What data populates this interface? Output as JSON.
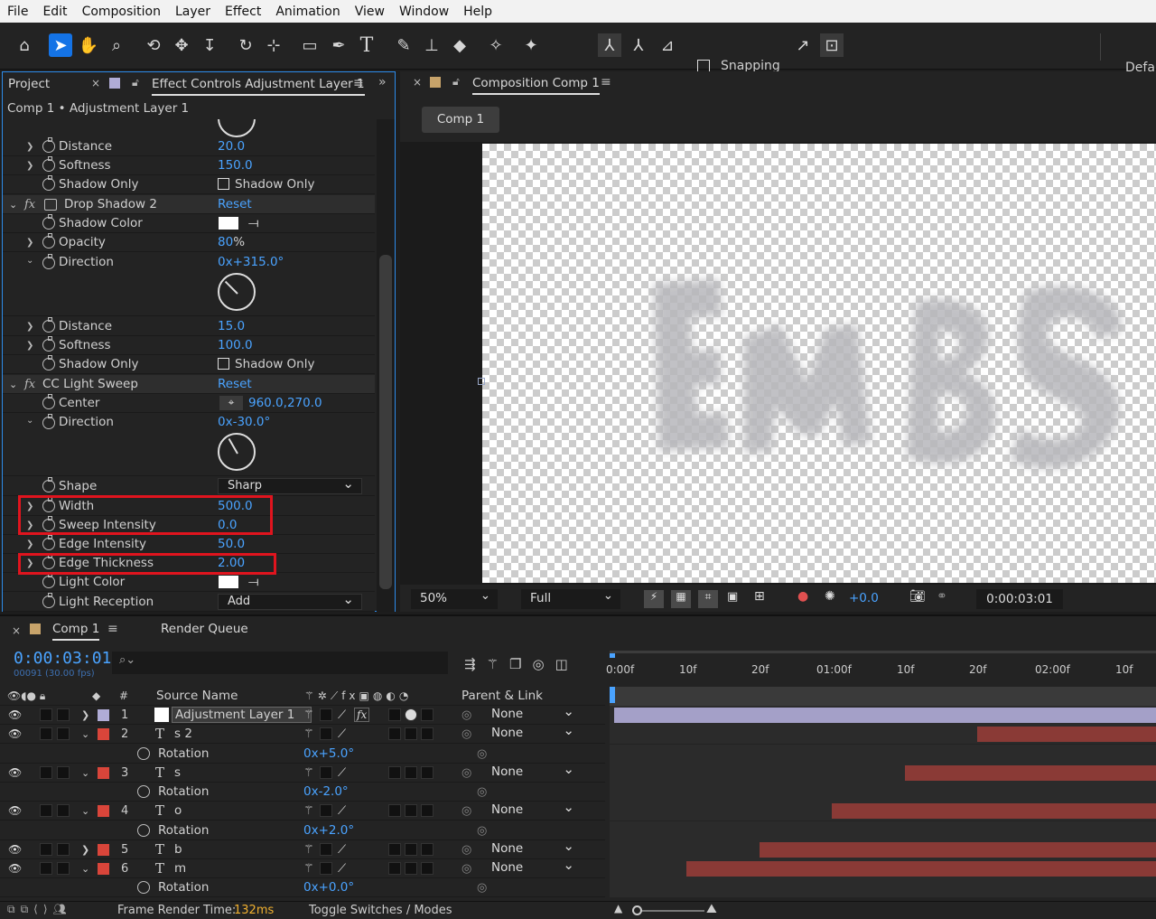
{
  "menu": [
    "File",
    "Edit",
    "Composition",
    "Layer",
    "Effect",
    "Animation",
    "View",
    "Window",
    "Help"
  ],
  "toolbar": {
    "snapping_label": "Snapping",
    "workspace": "Defau"
  },
  "effect_controls": {
    "tab_project": "Project",
    "tab_title": "Effect Controls Adjustment Layer 1",
    "breadcrumb": "Comp 1 • Adjustment Layer 1",
    "rows": {
      "distance1": {
        "label": "Distance",
        "value": "20.0"
      },
      "softness1": {
        "label": "Softness",
        "value": "150.0"
      },
      "shadow_only1": {
        "label": "Shadow Only",
        "value": "Shadow Only"
      },
      "drop_shadow2": {
        "label": "Drop Shadow 2",
        "value": "Reset"
      },
      "shadow_color": {
        "label": "Shadow Color"
      },
      "opacity": {
        "label": "Opacity",
        "value": "80",
        "unit": "%"
      },
      "direction1": {
        "label": "Direction",
        "value": "0x+315.0°"
      },
      "distance2": {
        "label": "Distance",
        "value": "15.0"
      },
      "softness2": {
        "label": "Softness",
        "value": "100.0"
      },
      "shadow_only2": {
        "label": "Shadow Only",
        "value": "Shadow Only"
      },
      "light_sweep": {
        "label": "CC Light Sweep",
        "value": "Reset"
      },
      "center": {
        "label": "Center",
        "value": "960.0,270.0"
      },
      "direction2": {
        "label": "Direction",
        "value": "0x-30.0°"
      },
      "shape": {
        "label": "Shape",
        "value": "Sharp"
      },
      "width": {
        "label": "Width",
        "value": "500.0"
      },
      "sweep_intensity": {
        "label": "Sweep Intensity",
        "value": "0.0"
      },
      "edge_intensity": {
        "label": "Edge Intensity",
        "value": "50.0"
      },
      "edge_thickness": {
        "label": "Edge Thickness",
        "value": "2.00"
      },
      "light_color": {
        "label": "Light Color"
      },
      "light_reception": {
        "label": "Light Reception",
        "value": "Add"
      }
    }
  },
  "composition": {
    "tab_title": "Composition Comp 1",
    "comp_button": "Comp 1",
    "footer": {
      "zoom": "50%",
      "resolution": "Full",
      "exposure": "+0.0",
      "timecode": "0:00:03:01"
    }
  },
  "timeline": {
    "tab_comp": "Comp 1",
    "tab_render": "Render Queue",
    "timecode": "0:00:03:01",
    "frame_info": "00091 (30.00 fps)",
    "col_source": "Source Name",
    "col_parent": "Parent & Link",
    "ruler": [
      "0:00f",
      "10f",
      "20f",
      "01:00f",
      "10f",
      "20f",
      "02:00f",
      "10f"
    ],
    "layers": [
      {
        "num": "1",
        "name": "Adjustment Layer 1",
        "parent": "None"
      },
      {
        "num": "2",
        "name": "s 2",
        "parent": "None"
      },
      {
        "prop": "Rotation",
        "value": "0x+5.0°"
      },
      {
        "num": "3",
        "name": "s",
        "parent": "None"
      },
      {
        "prop": "Rotation",
        "value": "0x-2.0°"
      },
      {
        "num": "4",
        "name": "o",
        "parent": "None"
      },
      {
        "prop": "Rotation",
        "value": "0x+2.0°"
      },
      {
        "num": "5",
        "name": "b",
        "parent": "None"
      },
      {
        "num": "6",
        "name": "m",
        "parent": "None"
      },
      {
        "prop": "Rotation",
        "value": "0x+0.0°"
      }
    ],
    "bottom": {
      "render_label": "Frame Render Time:",
      "render_value": "132ms",
      "toggle": "Toggle Switches / Modes"
    }
  },
  "colors": {
    "accent": "#2d8ceb",
    "value_blue": "#4aa3ff",
    "label_red": "#d9453a",
    "highlight_red": "#e0141e",
    "adjustment_bar": "#a4a0c8",
    "layer_bar": "#8a3a36"
  }
}
